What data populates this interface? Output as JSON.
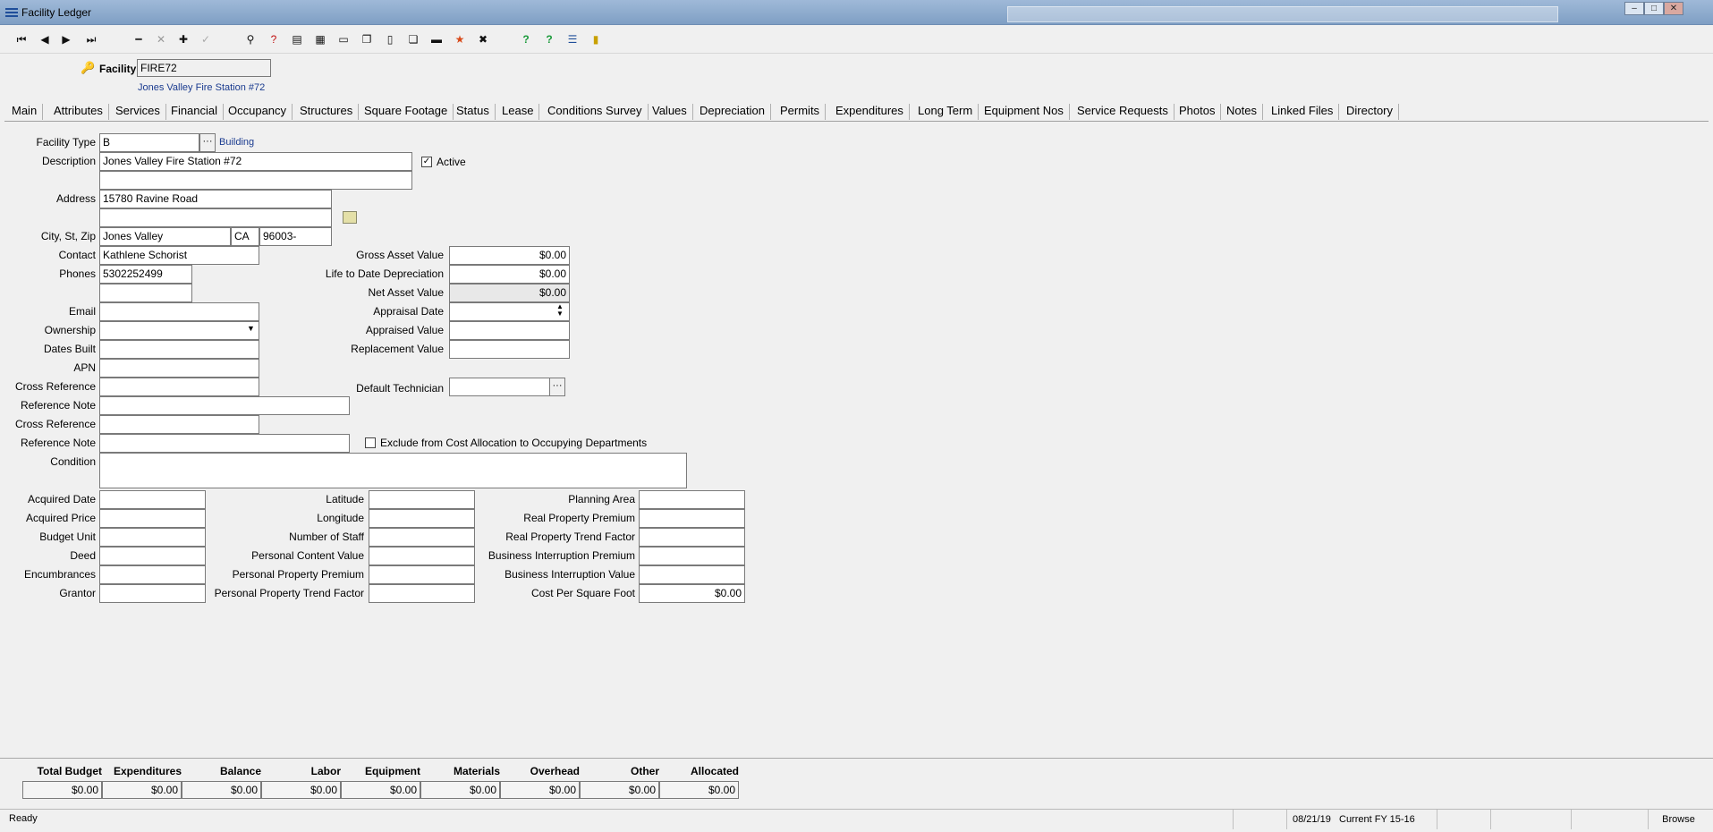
{
  "window": {
    "title": "Facility Ledger"
  },
  "toolbar": {
    "buttons": [
      {
        "name": "first-record-icon",
        "glyph": "⏮"
      },
      {
        "name": "prev-record-icon",
        "glyph": "◀"
      },
      {
        "name": "next-record-icon",
        "glyph": "▶"
      },
      {
        "name": "last-record-icon",
        "glyph": "⏭"
      },
      {
        "name": "delete-icon",
        "glyph": "━"
      },
      {
        "name": "cancel-icon",
        "glyph": "✕"
      },
      {
        "name": "add-icon",
        "glyph": "✚"
      },
      {
        "name": "post-icon",
        "glyph": "✓"
      },
      {
        "name": "filter-icon",
        "glyph": "⚲"
      },
      {
        "name": "query-icon",
        "glyph": "?"
      },
      {
        "name": "report-icon",
        "glyph": "▤"
      },
      {
        "name": "calculator-icon",
        "glyph": "▦"
      },
      {
        "name": "folder-icon",
        "glyph": "▭"
      },
      {
        "name": "copy-icon",
        "glyph": "❐"
      },
      {
        "name": "document-icon",
        "glyph": "▯"
      },
      {
        "name": "pages-icon",
        "glyph": "❏"
      },
      {
        "name": "print-icon",
        "glyph": "▬"
      },
      {
        "name": "favorite-icon",
        "glyph": "★"
      },
      {
        "name": "tools-icon",
        "glyph": "✖"
      },
      {
        "name": "help-icon",
        "glyph": "?"
      },
      {
        "name": "help-context-icon",
        "glyph": "?"
      },
      {
        "name": "list-icon",
        "glyph": "☰"
      },
      {
        "name": "exit-icon",
        "glyph": "▮"
      }
    ]
  },
  "header": {
    "facility_label": "Facility",
    "facility_code": "FIRE72",
    "facility_name": "Jones Valley Fire Station #72"
  },
  "tabs": [
    "Main",
    "Attributes",
    "Services",
    "Financial",
    "Occupancy",
    "Structures",
    "Square Footage",
    "Status",
    "Lease",
    "Conditions Survey",
    "Values",
    "Depreciation",
    "Permits",
    "Expenditures",
    "Long Term",
    "Equipment Nos",
    "Service Requests",
    "Photos",
    "Notes",
    "Linked Files",
    "Directory"
  ],
  "form": {
    "facility_type_label": "Facility Type",
    "facility_type": "B",
    "facility_type_desc": "Building",
    "description_label": "Description",
    "description": "Jones Valley Fire Station #72",
    "description2": "",
    "active_label": "Active",
    "address_label": "Address",
    "address1": "15780 Ravine Road",
    "address2": "",
    "csz_label": "City, St, Zip",
    "city": "Jones Valley",
    "state": "CA",
    "zip": "96003-",
    "contact_label": "Contact",
    "contact": "Kathlene Schorist",
    "phones_label": "Phones",
    "phone1": "5302252499",
    "phone2": "",
    "email_label": "Email",
    "ownership_label": "Ownership",
    "dates_built_label": "Dates Built",
    "apn_label": "APN",
    "cross_ref_label": "Cross Reference",
    "ref_note_label": "Reference Note",
    "exclude_label": "Exclude from Cost Allocation to Occupying Departments",
    "condition_label": "Condition",
    "gross_asset_label": "Gross Asset Value",
    "gross_asset": "$0.00",
    "ltd_depr_label": "Life to Date Depreciation",
    "ltd_depr": "$0.00",
    "net_asset_label": "Net Asset Value",
    "net_asset": "$0.00",
    "appraisal_date_label": "Appraisal Date",
    "appraised_value_label": "Appraised Value",
    "replacement_value_label": "Replacement Value",
    "default_tech_label": "Default Technician",
    "acquired_date_label": "Acquired Date",
    "acquired_price_label": "Acquired Price",
    "budget_unit_label": "Budget Unit",
    "deed_label": "Deed",
    "encumbrances_label": "Encumbrances",
    "grantor_label": "Grantor",
    "latitude_label": "Latitude",
    "longitude_label": "Longitude",
    "num_staff_label": "Number of Staff",
    "personal_content_label": "Personal Content Value",
    "personal_premium_label": "Personal Property Premium",
    "personal_trend_label": "Personal Property Trend Factor",
    "planning_area_label": "Planning Area",
    "real_premium_label": "Real Property Premium",
    "real_trend_label": "Real Property Trend Factor",
    "bi_premium_label": "Business Interruption Premium",
    "bi_value_label": "Business Interruption Value",
    "cost_sqft_label": "Cost Per Square Foot",
    "cost_sqft": "$0.00"
  },
  "summary": {
    "headers": [
      "Total Budget",
      "Expenditures",
      "Balance",
      "Labor",
      "Equipment",
      "Materials",
      "Overhead",
      "Other",
      "Allocated"
    ],
    "values": [
      "$0.00",
      "$0.00",
      "$0.00",
      "$0.00",
      "$0.00",
      "$0.00",
      "$0.00",
      "$0.00",
      "$0.00"
    ]
  },
  "status": {
    "message": "Ready",
    "date": "08/21/19",
    "fiscal_year": "Current FY 15-16",
    "mode": "Browse"
  }
}
